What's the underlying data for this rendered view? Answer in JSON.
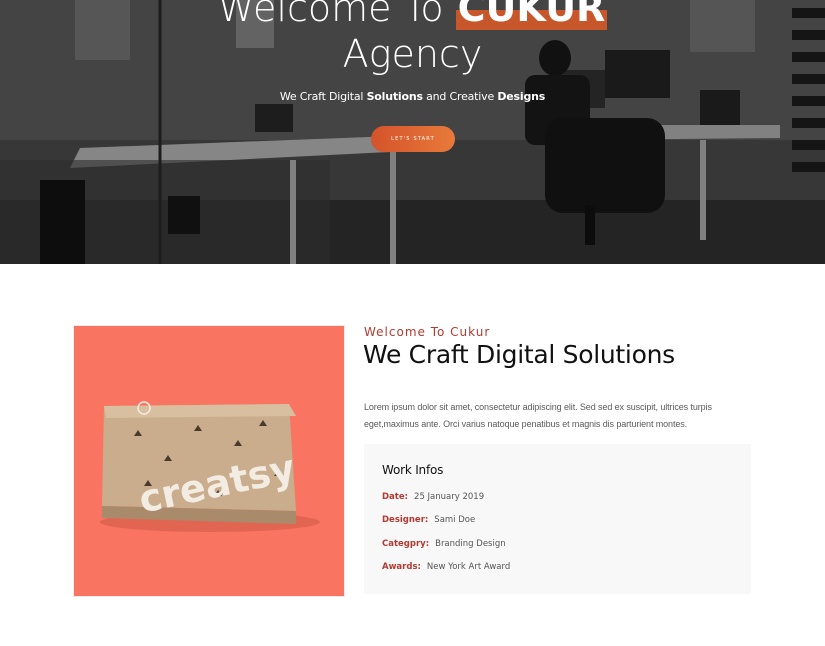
{
  "hero": {
    "title_prefix": "Welcome To",
    "title_brand": "CUKUR",
    "title_line2": "Agency",
    "subtitle": {
      "part1": "We Craft Digital",
      "bold1": "Solutions",
      "part2": "and Creative",
      "bold2": "Designs"
    },
    "cta_label": "LET'S START"
  },
  "about": {
    "eyebrow": "Welcome To Cukur",
    "headline": "We Craft Digital Solutions",
    "body": "Lorem ipsum dolor sit amet, consectetur adipiscing elit. Sed sed ex suscipit, ultrices turpis eget,maximus ante. Orci varius natoque penatibus et magnis dis parturient montes.",
    "product_text": "creatsy",
    "work_infos": {
      "title": "Work Infos",
      "rows": [
        {
          "label": "Date:",
          "value": "25 January 2019"
        },
        {
          "label": "Designer:",
          "value": "Sami Doe"
        },
        {
          "label": "Categpry:",
          "value": "Branding Design"
        },
        {
          "label": "Awards:",
          "value": "New York Art Award"
        }
      ]
    }
  },
  "colors": {
    "accent": "#b23a31",
    "cta_start": "#d4532b",
    "cta_end": "#e87a3a",
    "image_bg": "#f97561"
  }
}
